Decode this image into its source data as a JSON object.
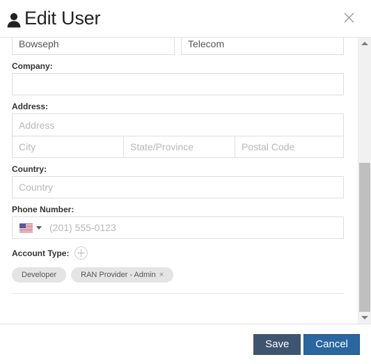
{
  "dialog": {
    "title": "Edit User",
    "title_icon": "user-icon",
    "close_icon": "close-icon"
  },
  "form": {
    "top_row": {
      "first_value": "Bowseph",
      "second_value": "Telecom"
    },
    "company": {
      "label": "Company:",
      "value": "",
      "placeholder": ""
    },
    "address": {
      "label": "Address:",
      "street_placeholder": "Address",
      "street_value": "",
      "city_placeholder": "City",
      "city_value": "",
      "state_placeholder": "State/Province",
      "state_value": "",
      "postal_placeholder": "Postal Code",
      "postal_value": ""
    },
    "country": {
      "label": "Country:",
      "placeholder": "Country",
      "value": ""
    },
    "phone": {
      "label": "Phone Number:",
      "placeholder": "(201) 555-0123",
      "value": "",
      "country_flag": "us-flag-icon",
      "caret_icon": "chevron-down-icon"
    },
    "account_type": {
      "label": "Account Type:",
      "add_icon": "plus-circle-icon",
      "chips": [
        {
          "label": "Developer",
          "removable": false,
          "remove_icon": ""
        },
        {
          "label": "RAN Provider - Admin",
          "removable": true,
          "remove_icon": "×"
        }
      ]
    }
  },
  "scrollbar": {
    "up_icon": "chevron-up-icon",
    "down_icon": "chevron-down-icon"
  },
  "footer": {
    "save_label": "Save",
    "cancel_label": "Cancel"
  },
  "colors": {
    "save_bg": "#3e5570",
    "cancel_bg": "#2a679e",
    "border": "#dedede",
    "placeholder": "#b8b8b8",
    "chip_bg": "#e4e4e4"
  }
}
